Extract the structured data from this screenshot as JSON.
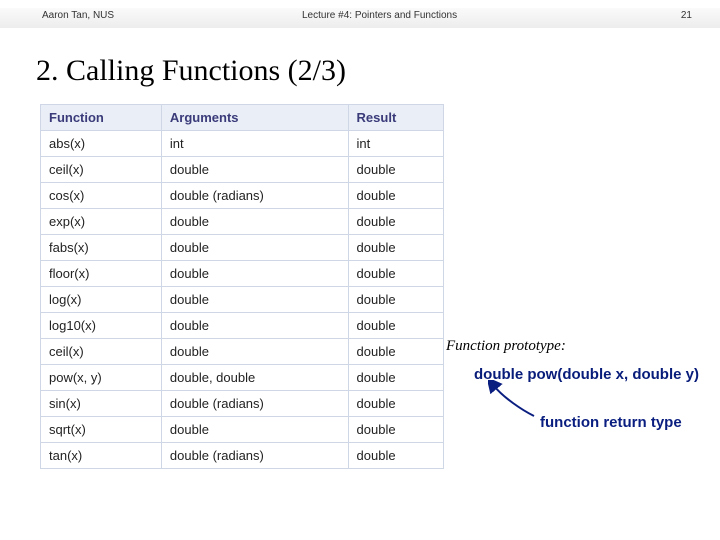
{
  "topbar": {
    "left": "Aaron Tan, NUS",
    "center": "Lecture #4: Pointers and Functions",
    "right": "21"
  },
  "title": "2. Calling Functions (2/3)",
  "table": {
    "headers": [
      "Function",
      "Arguments",
      "Result"
    ],
    "rows": [
      [
        "abs(x)",
        "int",
        "int"
      ],
      [
        "ceil(x)",
        "double",
        "double"
      ],
      [
        "cos(x)",
        "double (radians)",
        "double"
      ],
      [
        "exp(x)",
        "double",
        "double"
      ],
      [
        "fabs(x)",
        "double",
        "double"
      ],
      [
        "floor(x)",
        "double",
        "double"
      ],
      [
        "log(x)",
        "double",
        "double"
      ],
      [
        "log10(x)",
        "double",
        "double"
      ],
      [
        "ceil(x)",
        "double",
        "double"
      ],
      [
        "pow(x, y)",
        "double, double",
        "double"
      ],
      [
        "sin(x)",
        "double (radians)",
        "double"
      ],
      [
        "sqrt(x)",
        "double",
        "double"
      ],
      [
        "tan(x)",
        "double (radians)",
        "double"
      ]
    ]
  },
  "annotation": {
    "label": "Function prototype:",
    "prototype": "double pow(double x, double y)",
    "return_type_label": "function return type"
  }
}
